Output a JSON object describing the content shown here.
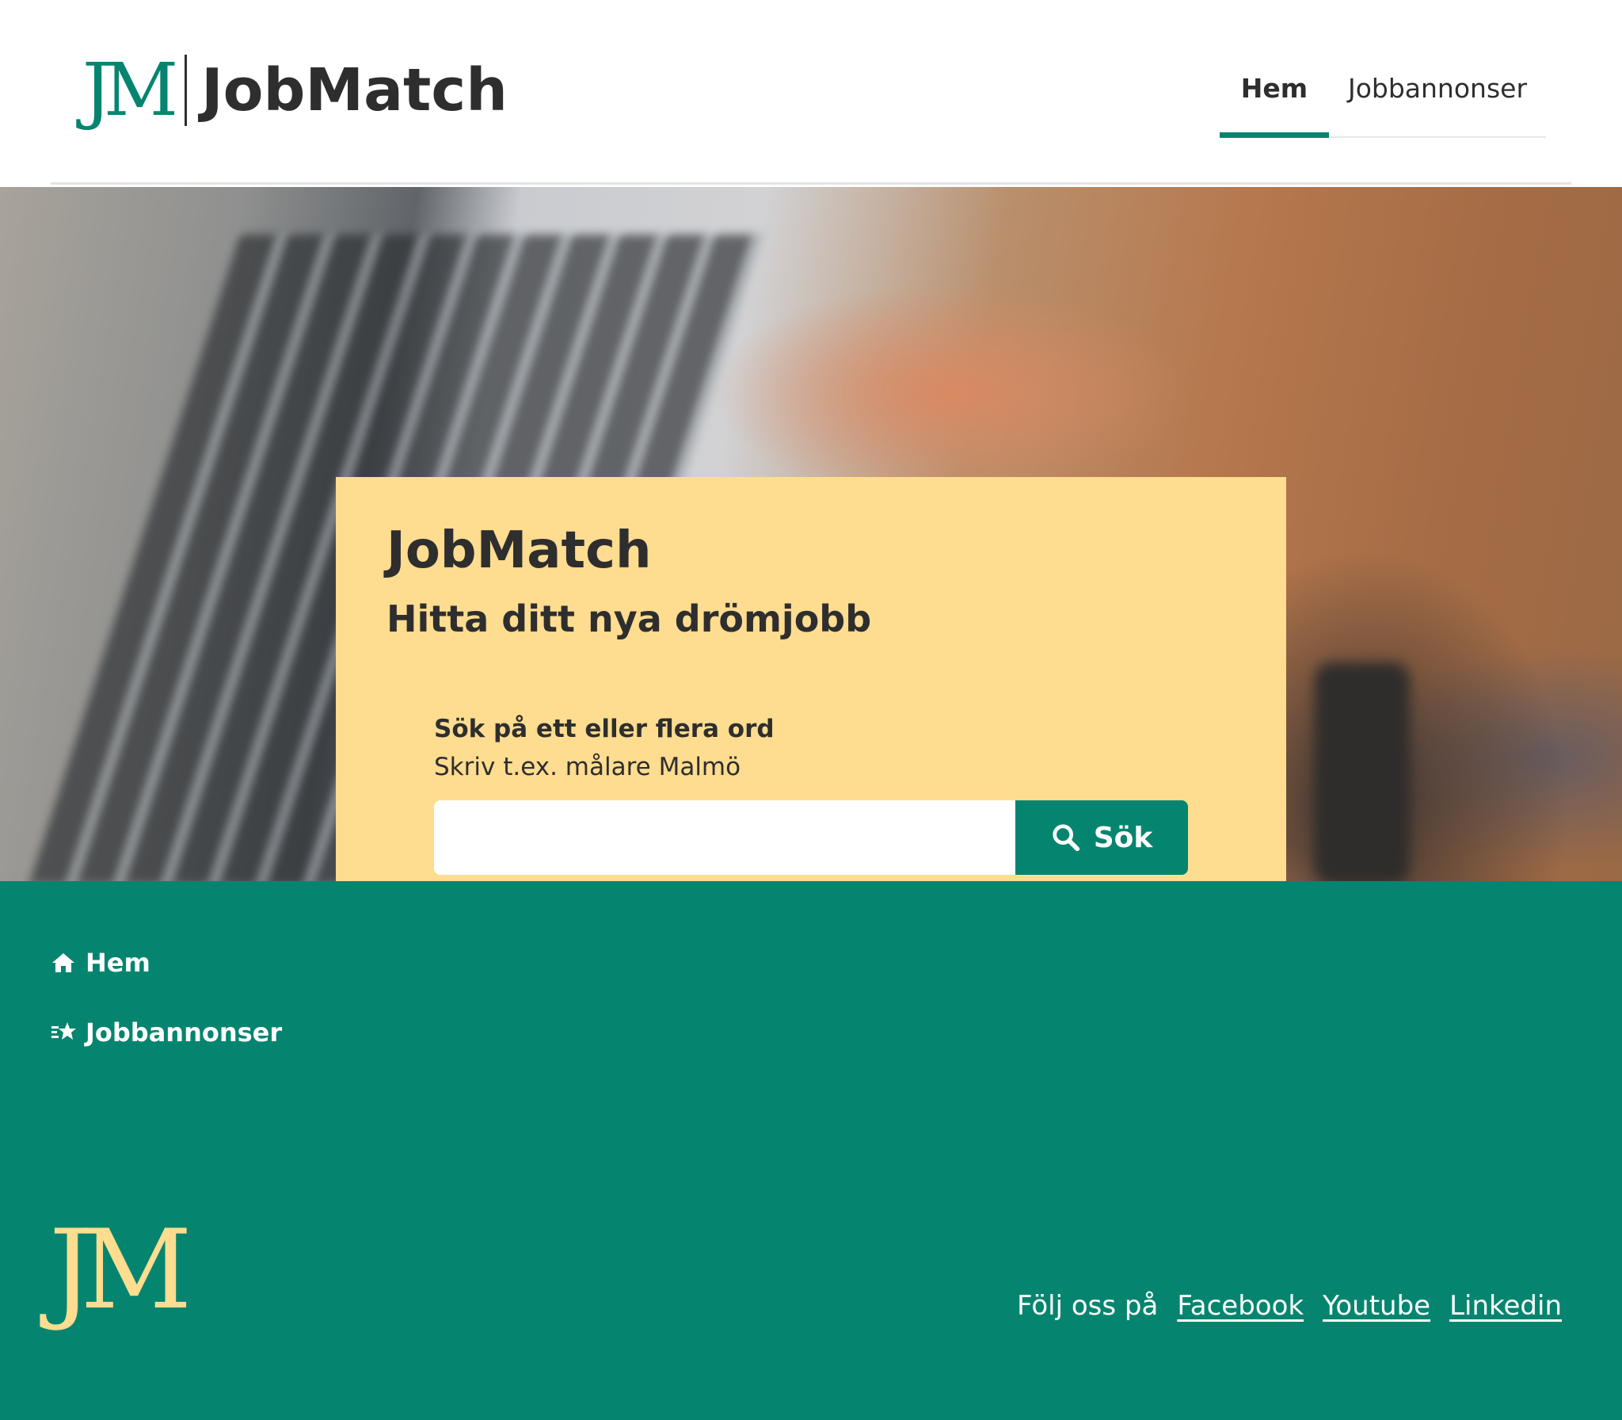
{
  "header": {
    "logo_mark": "JM",
    "logo_text": "JobMatch",
    "nav": [
      {
        "label": "Hem",
        "active": true
      },
      {
        "label": "Jobbannonser",
        "active": false
      }
    ]
  },
  "hero": {
    "title": "JobMatch",
    "subtitle": "Hitta ditt nya drömjobb",
    "search": {
      "label": "Sök på ett eller flera ord",
      "hint": "Skriv t.ex. målare Malmö",
      "value": "",
      "placeholder": "",
      "button_label": "Sök"
    }
  },
  "footer": {
    "links": [
      {
        "label": "Hem",
        "icon": "home-icon"
      },
      {
        "label": "Jobbannonser",
        "icon": "list-star-icon"
      }
    ],
    "logo_mark": "JM",
    "social": {
      "prefix": "Följ oss på",
      "links": [
        "Facebook",
        "Youtube",
        "Linkedin"
      ]
    }
  },
  "colors": {
    "brand_green": "#05856f",
    "card_yellow": "#fedc90",
    "text_dark": "#2e2e2e"
  }
}
